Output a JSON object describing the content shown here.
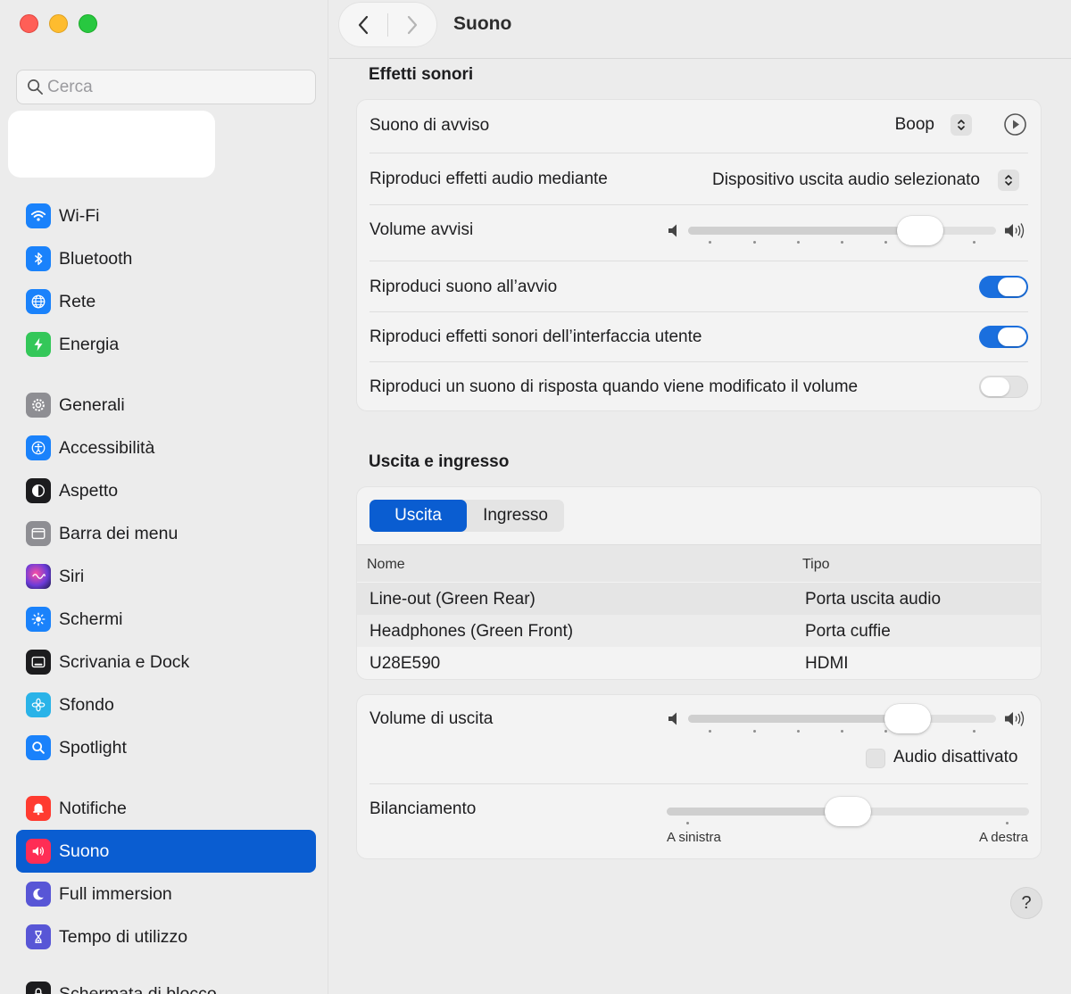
{
  "window": {
    "title": "Suono"
  },
  "search": {
    "placeholder": "Cerca"
  },
  "sidebar": {
    "items": [
      {
        "label": "Wi-Fi",
        "icon": "wifi-icon",
        "color": "#1a82fb"
      },
      {
        "label": "Bluetooth",
        "icon": "bluetooth-icon",
        "color": "#1a82fb"
      },
      {
        "label": "Rete",
        "icon": "globe-icon",
        "color": "#1a82fb"
      },
      {
        "label": "Energia",
        "icon": "bolt-icon",
        "color": "#34c759"
      },
      {
        "label": "Generali",
        "icon": "gear-icon",
        "color": "#8e8e93"
      },
      {
        "label": "Accessibilità",
        "icon": "accessibility-icon",
        "color": "#1a82fb"
      },
      {
        "label": "Aspetto",
        "icon": "appearance-icon",
        "color": "#1c1c1e"
      },
      {
        "label": "Barra dei menu",
        "icon": "menubar-icon",
        "color": "#8e8e93"
      },
      {
        "label": "Siri",
        "icon": "siri-icon",
        "color": "#5a2ea6"
      },
      {
        "label": "Schermi",
        "icon": "sun-icon",
        "color": "#1a82fb"
      },
      {
        "label": "Scrivania e Dock",
        "icon": "dock-icon",
        "color": "#1c1c1e"
      },
      {
        "label": "Sfondo",
        "icon": "flower-icon",
        "color": "#2ab3e8"
      },
      {
        "label": "Spotlight",
        "icon": "search-icon",
        "color": "#1a82fb"
      },
      {
        "label": "Notifiche",
        "icon": "bell-icon",
        "color": "#ff3b30"
      },
      {
        "label": "Suono",
        "icon": "speaker-icon",
        "color": "#ff2d55",
        "active": true
      },
      {
        "label": "Full immersion",
        "icon": "moon-icon",
        "color": "#5856d6"
      },
      {
        "label": "Tempo di utilizzo",
        "icon": "hourglass-icon",
        "color": "#5856d6"
      },
      {
        "label": "Schermata di blocco",
        "icon": "lock-icon",
        "color": "#1c1c1e"
      }
    ]
  },
  "effects": {
    "title": "Effetti sonori",
    "alert_sound_label": "Suono di avviso",
    "alert_sound_value": "Boop",
    "play_via_label": "Riproduci effetti audio mediante",
    "play_via_value": "Dispositivo uscita audio selezionato",
    "alert_volume_label": "Volume avvisi",
    "alert_volume_level": 0.8,
    "startup_label": "Riproduci suono all’avvio",
    "startup_on": true,
    "ui_sounds_label": "Riproduci effetti sonori dell’interfaccia utente",
    "ui_sounds_on": true,
    "feedback_label": "Riproduci un suono di risposta quando viene modificato il volume",
    "feedback_on": false
  },
  "io": {
    "title": "Uscita e ingresso",
    "tabs": [
      "Uscita",
      "Ingresso"
    ],
    "selected_tab": "Uscita",
    "columns": [
      "Nome",
      "Tipo"
    ],
    "devices": [
      {
        "name": "Line-out (Green Rear)",
        "type": "Porta uscita audio",
        "selected": true
      },
      {
        "name": "Headphones (Green Front)",
        "type": "Porta cuffie"
      },
      {
        "name": "U28E590",
        "type": "HDMI"
      }
    ]
  },
  "output": {
    "volume_label": "Volume di uscita",
    "volume_level": 0.75,
    "mute_label": "Audio disattivato",
    "muted": false,
    "balance_label": "Bilanciamento",
    "balance_level": 0.5,
    "left_label": "A sinistra",
    "right_label": "A destra"
  },
  "help": {
    "label": "?"
  }
}
